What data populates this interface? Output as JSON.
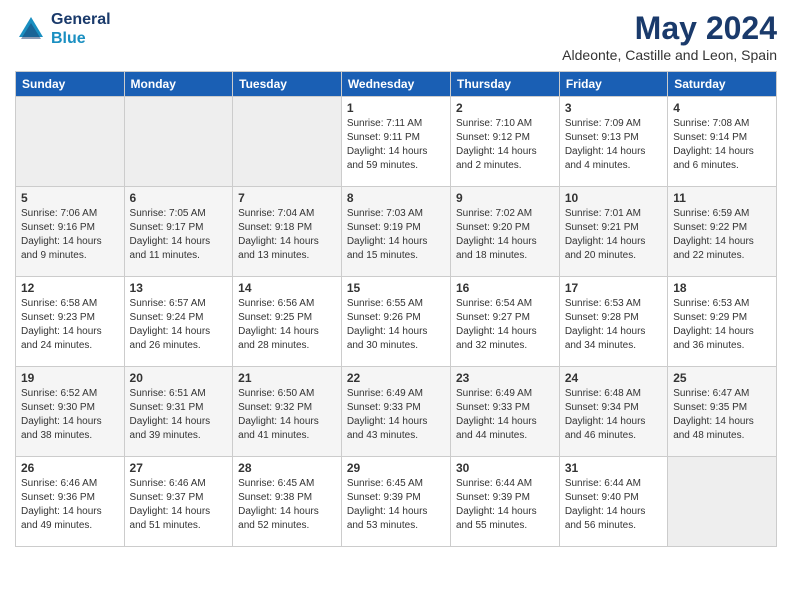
{
  "header": {
    "logo_line1": "General",
    "logo_line2": "Blue",
    "month_title": "May 2024",
    "location": "Aldeonte, Castille and Leon, Spain"
  },
  "days_of_week": [
    "Sunday",
    "Monday",
    "Tuesday",
    "Wednesday",
    "Thursday",
    "Friday",
    "Saturday"
  ],
  "weeks": [
    [
      {
        "num": "",
        "info": ""
      },
      {
        "num": "",
        "info": ""
      },
      {
        "num": "",
        "info": ""
      },
      {
        "num": "1",
        "info": "Sunrise: 7:11 AM\nSunset: 9:11 PM\nDaylight: 14 hours\nand 59 minutes."
      },
      {
        "num": "2",
        "info": "Sunrise: 7:10 AM\nSunset: 9:12 PM\nDaylight: 14 hours\nand 2 minutes."
      },
      {
        "num": "3",
        "info": "Sunrise: 7:09 AM\nSunset: 9:13 PM\nDaylight: 14 hours\nand 4 minutes."
      },
      {
        "num": "4",
        "info": "Sunrise: 7:08 AM\nSunset: 9:14 PM\nDaylight: 14 hours\nand 6 minutes."
      }
    ],
    [
      {
        "num": "5",
        "info": "Sunrise: 7:06 AM\nSunset: 9:16 PM\nDaylight: 14 hours\nand 9 minutes."
      },
      {
        "num": "6",
        "info": "Sunrise: 7:05 AM\nSunset: 9:17 PM\nDaylight: 14 hours\nand 11 minutes."
      },
      {
        "num": "7",
        "info": "Sunrise: 7:04 AM\nSunset: 9:18 PM\nDaylight: 14 hours\nand 13 minutes."
      },
      {
        "num": "8",
        "info": "Sunrise: 7:03 AM\nSunset: 9:19 PM\nDaylight: 14 hours\nand 15 minutes."
      },
      {
        "num": "9",
        "info": "Sunrise: 7:02 AM\nSunset: 9:20 PM\nDaylight: 14 hours\nand 18 minutes."
      },
      {
        "num": "10",
        "info": "Sunrise: 7:01 AM\nSunset: 9:21 PM\nDaylight: 14 hours\nand 20 minutes."
      },
      {
        "num": "11",
        "info": "Sunrise: 6:59 AM\nSunset: 9:22 PM\nDaylight: 14 hours\nand 22 minutes."
      }
    ],
    [
      {
        "num": "12",
        "info": "Sunrise: 6:58 AM\nSunset: 9:23 PM\nDaylight: 14 hours\nand 24 minutes."
      },
      {
        "num": "13",
        "info": "Sunrise: 6:57 AM\nSunset: 9:24 PM\nDaylight: 14 hours\nand 26 minutes."
      },
      {
        "num": "14",
        "info": "Sunrise: 6:56 AM\nSunset: 9:25 PM\nDaylight: 14 hours\nand 28 minutes."
      },
      {
        "num": "15",
        "info": "Sunrise: 6:55 AM\nSunset: 9:26 PM\nDaylight: 14 hours\nand 30 minutes."
      },
      {
        "num": "16",
        "info": "Sunrise: 6:54 AM\nSunset: 9:27 PM\nDaylight: 14 hours\nand 32 minutes."
      },
      {
        "num": "17",
        "info": "Sunrise: 6:53 AM\nSunset: 9:28 PM\nDaylight: 14 hours\nand 34 minutes."
      },
      {
        "num": "18",
        "info": "Sunrise: 6:53 AM\nSunset: 9:29 PM\nDaylight: 14 hours\nand 36 minutes."
      }
    ],
    [
      {
        "num": "19",
        "info": "Sunrise: 6:52 AM\nSunset: 9:30 PM\nDaylight: 14 hours\nand 38 minutes."
      },
      {
        "num": "20",
        "info": "Sunrise: 6:51 AM\nSunset: 9:31 PM\nDaylight: 14 hours\nand 39 minutes."
      },
      {
        "num": "21",
        "info": "Sunrise: 6:50 AM\nSunset: 9:32 PM\nDaylight: 14 hours\nand 41 minutes."
      },
      {
        "num": "22",
        "info": "Sunrise: 6:49 AM\nSunset: 9:33 PM\nDaylight: 14 hours\nand 43 minutes."
      },
      {
        "num": "23",
        "info": "Sunrise: 6:49 AM\nSunset: 9:33 PM\nDaylight: 14 hours\nand 44 minutes."
      },
      {
        "num": "24",
        "info": "Sunrise: 6:48 AM\nSunset: 9:34 PM\nDaylight: 14 hours\nand 46 minutes."
      },
      {
        "num": "25",
        "info": "Sunrise: 6:47 AM\nSunset: 9:35 PM\nDaylight: 14 hours\nand 48 minutes."
      }
    ],
    [
      {
        "num": "26",
        "info": "Sunrise: 6:46 AM\nSunset: 9:36 PM\nDaylight: 14 hours\nand 49 minutes."
      },
      {
        "num": "27",
        "info": "Sunrise: 6:46 AM\nSunset: 9:37 PM\nDaylight: 14 hours\nand 51 minutes."
      },
      {
        "num": "28",
        "info": "Sunrise: 6:45 AM\nSunset: 9:38 PM\nDaylight: 14 hours\nand 52 minutes."
      },
      {
        "num": "29",
        "info": "Sunrise: 6:45 AM\nSunset: 9:39 PM\nDaylight: 14 hours\nand 53 minutes."
      },
      {
        "num": "30",
        "info": "Sunrise: 6:44 AM\nSunset: 9:39 PM\nDaylight: 14 hours\nand 55 minutes."
      },
      {
        "num": "31",
        "info": "Sunrise: 6:44 AM\nSunset: 9:40 PM\nDaylight: 14 hours\nand 56 minutes."
      },
      {
        "num": "",
        "info": ""
      }
    ]
  ]
}
